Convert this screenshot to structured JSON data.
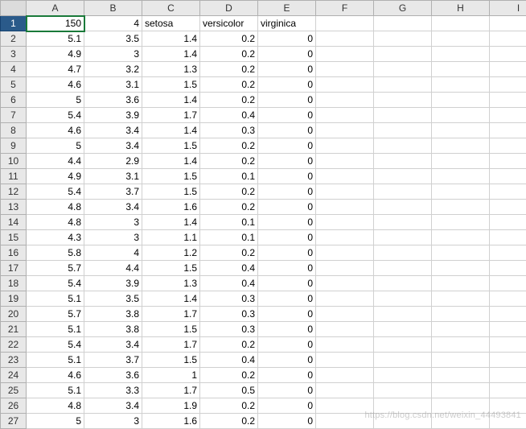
{
  "columns": [
    "A",
    "B",
    "C",
    "D",
    "E",
    "F",
    "G",
    "H",
    "I"
  ],
  "selected_row_header": 1,
  "active_cell": {
    "row": 1,
    "col": "A"
  },
  "rows": [
    {
      "n": 1,
      "c": {
        "A": "150",
        "B": "4",
        "C": "setosa",
        "D": "versicolor",
        "E": "virginica"
      },
      "types": {
        "A": "num",
        "B": "num",
        "C": "txt",
        "D": "txt",
        "E": "txt"
      }
    },
    {
      "n": 2,
      "c": {
        "A": "5.1",
        "B": "3.5",
        "C": "1.4",
        "D": "0.2",
        "E": "0"
      }
    },
    {
      "n": 3,
      "c": {
        "A": "4.9",
        "B": "3",
        "C": "1.4",
        "D": "0.2",
        "E": "0"
      }
    },
    {
      "n": 4,
      "c": {
        "A": "4.7",
        "B": "3.2",
        "C": "1.3",
        "D": "0.2",
        "E": "0"
      }
    },
    {
      "n": 5,
      "c": {
        "A": "4.6",
        "B": "3.1",
        "C": "1.5",
        "D": "0.2",
        "E": "0"
      }
    },
    {
      "n": 6,
      "c": {
        "A": "5",
        "B": "3.6",
        "C": "1.4",
        "D": "0.2",
        "E": "0"
      }
    },
    {
      "n": 7,
      "c": {
        "A": "5.4",
        "B": "3.9",
        "C": "1.7",
        "D": "0.4",
        "E": "0"
      }
    },
    {
      "n": 8,
      "c": {
        "A": "4.6",
        "B": "3.4",
        "C": "1.4",
        "D": "0.3",
        "E": "0"
      }
    },
    {
      "n": 9,
      "c": {
        "A": "5",
        "B": "3.4",
        "C": "1.5",
        "D": "0.2",
        "E": "0"
      }
    },
    {
      "n": 10,
      "c": {
        "A": "4.4",
        "B": "2.9",
        "C": "1.4",
        "D": "0.2",
        "E": "0"
      }
    },
    {
      "n": 11,
      "c": {
        "A": "4.9",
        "B": "3.1",
        "C": "1.5",
        "D": "0.1",
        "E": "0"
      }
    },
    {
      "n": 12,
      "c": {
        "A": "5.4",
        "B": "3.7",
        "C": "1.5",
        "D": "0.2",
        "E": "0"
      }
    },
    {
      "n": 13,
      "c": {
        "A": "4.8",
        "B": "3.4",
        "C": "1.6",
        "D": "0.2",
        "E": "0"
      }
    },
    {
      "n": 14,
      "c": {
        "A": "4.8",
        "B": "3",
        "C": "1.4",
        "D": "0.1",
        "E": "0"
      }
    },
    {
      "n": 15,
      "c": {
        "A": "4.3",
        "B": "3",
        "C": "1.1",
        "D": "0.1",
        "E": "0"
      }
    },
    {
      "n": 16,
      "c": {
        "A": "5.8",
        "B": "4",
        "C": "1.2",
        "D": "0.2",
        "E": "0"
      }
    },
    {
      "n": 17,
      "c": {
        "A": "5.7",
        "B": "4.4",
        "C": "1.5",
        "D": "0.4",
        "E": "0"
      }
    },
    {
      "n": 18,
      "c": {
        "A": "5.4",
        "B": "3.9",
        "C": "1.3",
        "D": "0.4",
        "E": "0"
      }
    },
    {
      "n": 19,
      "c": {
        "A": "5.1",
        "B": "3.5",
        "C": "1.4",
        "D": "0.3",
        "E": "0"
      }
    },
    {
      "n": 20,
      "c": {
        "A": "5.7",
        "B": "3.8",
        "C": "1.7",
        "D": "0.3",
        "E": "0"
      }
    },
    {
      "n": 21,
      "c": {
        "A": "5.1",
        "B": "3.8",
        "C": "1.5",
        "D": "0.3",
        "E": "0"
      }
    },
    {
      "n": 22,
      "c": {
        "A": "5.4",
        "B": "3.4",
        "C": "1.7",
        "D": "0.2",
        "E": "0"
      }
    },
    {
      "n": 23,
      "c": {
        "A": "5.1",
        "B": "3.7",
        "C": "1.5",
        "D": "0.4",
        "E": "0"
      }
    },
    {
      "n": 24,
      "c": {
        "A": "4.6",
        "B": "3.6",
        "C": "1",
        "D": "0.2",
        "E": "0"
      }
    },
    {
      "n": 25,
      "c": {
        "A": "5.1",
        "B": "3.3",
        "C": "1.7",
        "D": "0.5",
        "E": "0"
      }
    },
    {
      "n": 26,
      "c": {
        "A": "4.8",
        "B": "3.4",
        "C": "1.9",
        "D": "0.2",
        "E": "0"
      }
    },
    {
      "n": 27,
      "c": {
        "A": "5",
        "B": "3",
        "C": "1.6",
        "D": "0.2",
        "E": "0"
      }
    }
  ],
  "watermark": "https://blog.csdn.net/weixin_44493841"
}
